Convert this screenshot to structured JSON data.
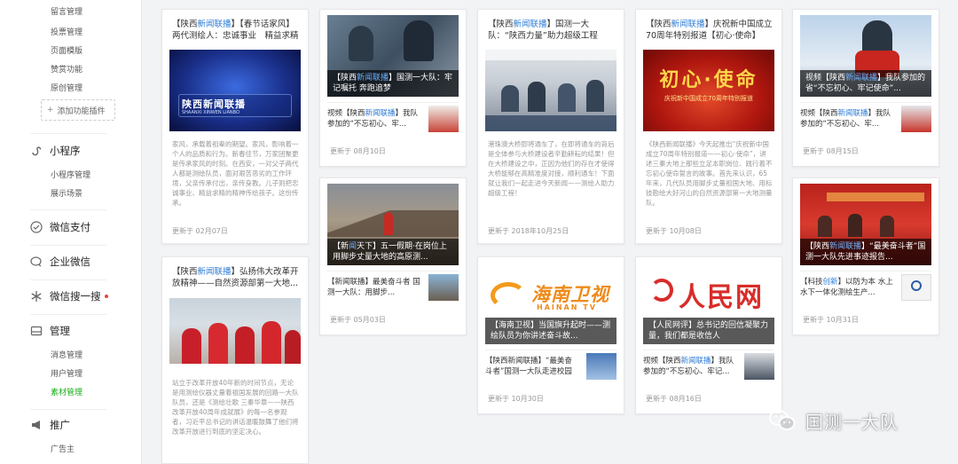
{
  "sidebar": {
    "top_items": [
      "留言管理",
      "投票管理",
      "页面模版",
      "赞赏功能",
      "原创管理"
    ],
    "add_plugin": "添加功能插件",
    "mini_program": {
      "label": "小程序",
      "items": [
        "小程序管理",
        "展示场景"
      ]
    },
    "wechat_pay": "微信支付",
    "enterprise_wechat": "企业微信",
    "wechat_search": "微信搜一搜",
    "manage": {
      "label": "管理",
      "items": [
        "消息管理",
        "用户管理",
        "素材管理"
      ]
    },
    "promotion": {
      "label": "推广",
      "items": [
        "广告主"
      ]
    }
  },
  "cards": [
    {
      "title_pre": "【陕西",
      "title_hl": "新闻联播",
      "title_post": "】【春节话家风】两代测绘人：忠诚事业　精益求精",
      "cover_text": "陕西新闻联播",
      "cover_sub": "SHAANXI  XINWEN  LIANBO",
      "desc": "家风，承载着祖辈的期望。家风，影响着一个人的品质和行为。新春佳节，万家团聚更是传承家风的时刻。在西安，一对父子两代人都是测绘队员，面对艰苦恶劣的工作环境，父亲传承付出，亲传身教。儿子则把忠诚事业、精益求精的精神传给孩子。这份传承。",
      "date": "更新于 02月07日"
    },
    {
      "title_pre": "【陕西",
      "title_hl": "新闻联播",
      "title_post": "】弘扬伟大改革开放精神——自然资源部第一大地...",
      "desc": "站立于改革开放40年新的时间节点，无论是用测绘仪器丈量着祖国发展的回路一大队队员，还是《测绘壮歌 三秦华章——陕西改革开放40周年成就展》的每一名参观者，习近平总书记的讲话温暖鼓舞了他们将改革开放进行到底的坚定决心。"
    },
    {
      "cover_caption_pre": "【陕西",
      "cover_caption_hl": "新闻联播",
      "cover_caption_post": "】国测一大队：牢记嘱托  奔跑追梦",
      "sub_pre": "视频【陕西",
      "sub_hl": "新闻联播",
      "sub_post": "】我队参加的“不忘初心、牢...",
      "date": "更新于 08月10日"
    },
    {
      "cover_caption_pre": "【新",
      "cover_caption_hl": "闻",
      "cover_caption_post": "天下】五一假期·在岗位上　用脚步丈量大地的高原测...",
      "sub_pre": "",
      "sub_hl": "",
      "sub_post": "【新闻联播】最美奋斗者  国测一大队：用脚步...",
      "date": "更新于 05月03日"
    },
    {
      "title_pre": "【陕西",
      "title_hl": "新闻联播",
      "title_post": "】国测一大队：“陕西力量”助力超级工程",
      "desc": "港珠澳大桥即将通车了，在即将通车的背后是全体参与大桥建设者辛勤耕耘的结果！但在大桥建设之中，正因为他们的存在才使得大桥能够在高精准度对接，顺利通车！下面就让我们一起走进今天新闻——测绘人助力超级工程！",
      "date": "更新于 2018年10月25日"
    },
    {
      "logo_cn": "海南卫视",
      "logo_en": "HAINAN TV",
      "cover_caption_pre": "【海南卫视】",
      "cover_caption_hl": "",
      "cover_caption_post": "当国旗升起时——测绘队员为你讲述奋斗故...",
      "sub_pre": "",
      "sub_hl": "",
      "sub_post": "【陕西新闻联播】“最美奋斗者”国测一大队走进校园",
      "date": "更新于 10月30日"
    },
    {
      "title_pre": "【陕西",
      "title_hl": "新闻联播",
      "title_post": "】庆祝新中国成立70周年特别报道【初心·使命】之...",
      "cover_text": "初心·使命",
      "cover_sub": "庆祝新中国成立70周年特别报道",
      "desc": "《陕西新闻联播》今天起推出“庆祝新中国成立70周年特别报道——初心·使命”，讲述三秦大地上那些立足本职岗位、践行着不忘初心使命誓言的故事。首先来认识，65年来，几代队员用脚步丈量祖国大地、用标技勘绘大好河山的自然资源部第一大地测量队。",
      "date": "更新于 10月08日"
    },
    {
      "cover_caption_pre": "【人民网评】",
      "cover_caption_hl": "",
      "cover_caption_post": "总书记的回信凝聚力量，我们都是收信人",
      "logo_text": "人民网",
      "sub_pre": "视频【陕西",
      "sub_hl": "新闻联播",
      "sub_post": "】我队参加的“不忘初心、牢记...",
      "date": "更新于 08月16日"
    },
    {
      "cover_caption_pre": "视频【陕西",
      "cover_caption_hl": "新闻联播",
      "cover_caption_post": "】我队参加的省“不忘初心、牢记使命”...",
      "sub_pre": "视频【陕西",
      "sub_hl": "新闻联播",
      "sub_post": "】我队参加的“不忘初心、牢...",
      "date": "更新于 08月15日"
    },
    {
      "cover_caption_pre": "【陕西",
      "cover_caption_hl": "新闻联播",
      "cover_caption_post": "】“最美奋斗者”国测一大队先进事迹报告...",
      "sub_pre": "【科技",
      "sub_hl": "创新",
      "sub_post": "】以防为本  水上水下一体化测绘生产...",
      "date": "更新于 10月31日"
    }
  ],
  "watermark": "国测一大队"
}
